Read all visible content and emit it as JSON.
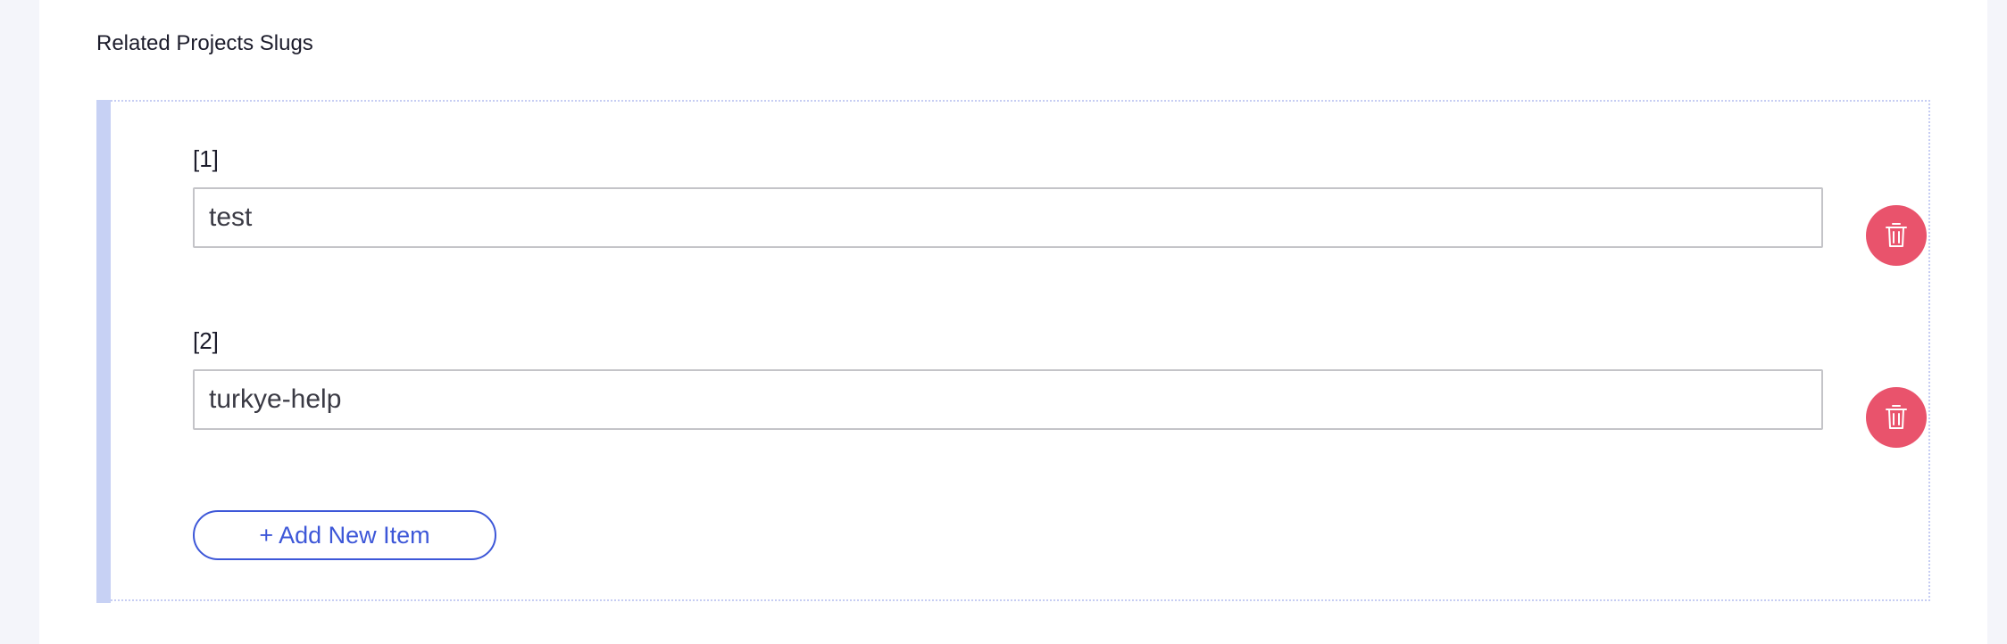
{
  "field": {
    "label": "Related Projects Slugs"
  },
  "repeater": {
    "items": [
      {
        "index_label": "[1]",
        "value": "test"
      },
      {
        "index_label": "[2]",
        "value": "turkye-help"
      }
    ],
    "add_label": "+ Add New Item"
  },
  "icons": {
    "delete": "trash-icon"
  },
  "colors": {
    "accent": "#3d57d8",
    "danger": "#e9536c",
    "repeater_bar": "#c7d1f4",
    "page_background": "#f4f5fa"
  }
}
